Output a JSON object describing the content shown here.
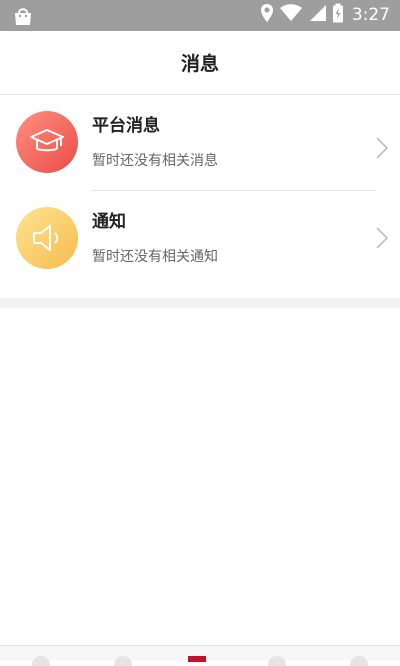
{
  "status_bar": {
    "time": "3:27",
    "icons": [
      "shopping-bag-icon",
      "location-icon",
      "wifi-icon",
      "signal-icon",
      "battery-icon"
    ]
  },
  "header": {
    "title": "消息"
  },
  "messages": [
    {
      "title": "平台消息",
      "subtitle": "暂时还没有相关消息",
      "icon": "graduation-cap-icon",
      "icon_gradient": [
        "#ff8a7a",
        "#ec4f4a"
      ]
    },
    {
      "title": "通知",
      "subtitle": "暂时还没有相关通知",
      "icon": "speaker-icon",
      "icon_gradient": [
        "#ffe38c",
        "#f6bd52"
      ]
    }
  ],
  "colors": {
    "accent": "#c8102e",
    "status_bar": "#9e9e9e"
  }
}
